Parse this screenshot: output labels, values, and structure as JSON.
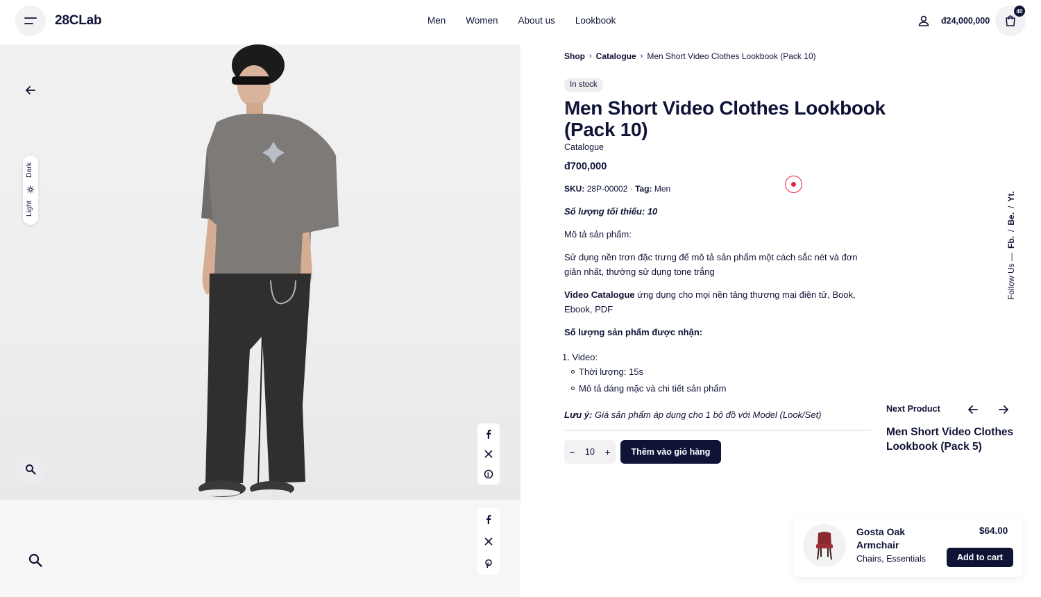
{
  "header": {
    "logo": "28CLab",
    "nav": [
      "Men",
      "Women",
      "About us",
      "Lookbook"
    ],
    "cart_total": "đ24,000,000",
    "cart_count": "40"
  },
  "gallery": {
    "mode_dark": "Dark",
    "mode_light": "Light"
  },
  "breadcrumb": {
    "shop": "Shop",
    "catalogue": "Catalogue",
    "current": "Men Short Video Clothes Lookbook (Pack 10)"
  },
  "product": {
    "stock": "In stock",
    "title": "Men Short Video Clothes Lookbook (Pack 10)",
    "category": "Catalogue",
    "price": "đ700,000",
    "sku_label": "SKU:",
    "sku": "28P-00002",
    "tag_label": "Tag:",
    "tag": "Men",
    "min_qty": "Số lượng tối thiểu: 10",
    "desc_heading": "Mô tả sản phẩm:",
    "desc_1": "Sử dụng nền trơn đặc trưng để mô tả sản phẩm một cách sắc nét và đơn giản nhất, thường sử dụng tone trắng",
    "desc_2_bold": "Video Catalogue",
    "desc_2": " ứng dụng cho mọi nền tảng thương mại điện tử, Book, Ebook, PDF",
    "received_heading": "Số lượng sản phẩm được nhận:",
    "list_item": "1. Video:",
    "sub_1": "Thời lượng: 15s",
    "sub_2": "Mô tả dáng mặc và chi tiết sản phẩm",
    "note_label": "Lưu ý:",
    "note": " Giá sản phẩm áp dụng cho 1 bộ đồ với Model (Look/Set)",
    "quantity": "10",
    "add_to_cart": "Thêm vào giỏ hàng"
  },
  "follow": {
    "label": "Follow Us —",
    "links": [
      "Fb.",
      "/",
      "Be.",
      "/",
      "Yt."
    ]
  },
  "next_product": {
    "label": "Next Product",
    "title": "Men Short Video Clothes Lookbook (Pack 5)"
  },
  "popup": {
    "name": "Gosta Oak Armchair",
    "categories": "Chairs, Essentials",
    "price": "$64.00",
    "button": "Add to cart"
  }
}
